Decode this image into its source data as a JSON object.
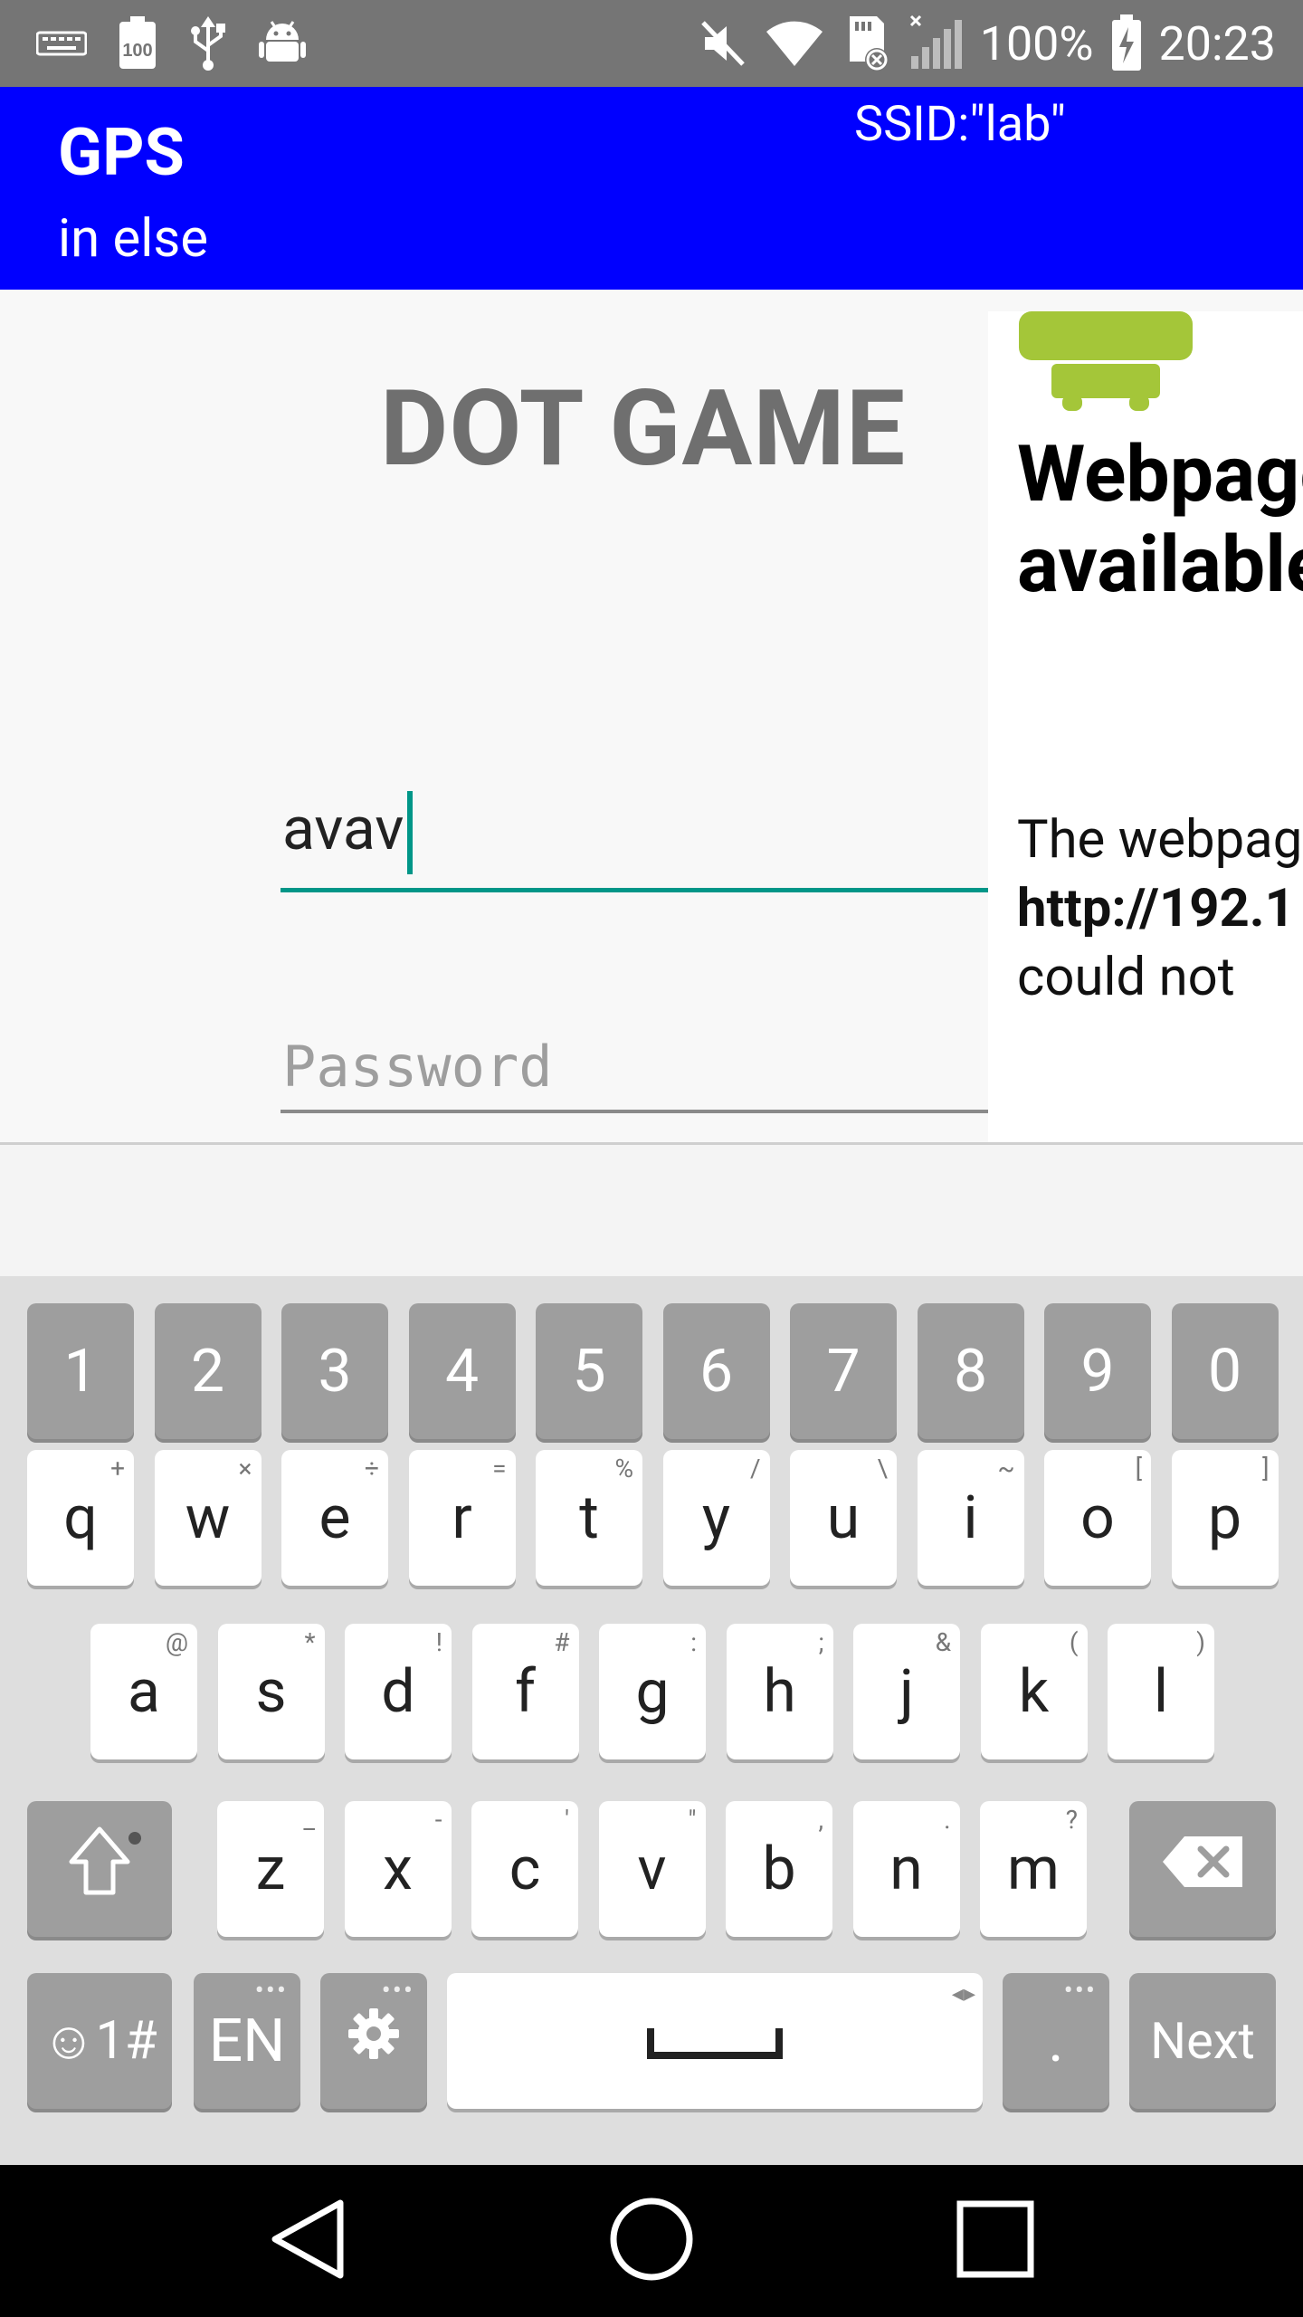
{
  "status_bar": {
    "battery_percent": "100%",
    "time": "20:23",
    "left_icons": [
      "keyboard-icon",
      "battery-100-icon",
      "usb-icon",
      "android-debug-icon"
    ],
    "right_icons": [
      "mute-icon",
      "wifi-icon",
      "sd-card-icon",
      "no-signal-icon",
      "battery-charging-icon"
    ]
  },
  "header": {
    "title": "GPS",
    "subtitle": "in else",
    "ssid": "SSID:\"lab\"",
    "color": "#0000ff"
  },
  "main": {
    "game_title": "DOT GAME",
    "username_value": "avav",
    "password_placeholder": "Password",
    "accent_color": "#009688"
  },
  "webview": {
    "heading": "Webpage not available",
    "message_prefix": "The webpage at",
    "url": "http://192.1",
    "message_suffix": "could not"
  },
  "keyboard": {
    "number_row": [
      "1",
      "2",
      "3",
      "4",
      "5",
      "6",
      "7",
      "8",
      "9",
      "0"
    ],
    "row1": [
      {
        "key": "q",
        "alt": "+"
      },
      {
        "key": "w",
        "alt": "×"
      },
      {
        "key": "e",
        "alt": "÷"
      },
      {
        "key": "r",
        "alt": "="
      },
      {
        "key": "t",
        "alt": "%"
      },
      {
        "key": "y",
        "alt": "/"
      },
      {
        "key": "u",
        "alt": "\\"
      },
      {
        "key": "i",
        "alt": "~"
      },
      {
        "key": "o",
        "alt": "["
      },
      {
        "key": "p",
        "alt": "]"
      }
    ],
    "row2": [
      {
        "key": "a",
        "alt": "@"
      },
      {
        "key": "s",
        "alt": "*"
      },
      {
        "key": "d",
        "alt": "!"
      },
      {
        "key": "f",
        "alt": "#"
      },
      {
        "key": "g",
        "alt": ":"
      },
      {
        "key": "h",
        "alt": ";"
      },
      {
        "key": "j",
        "alt": "&"
      },
      {
        "key": "k",
        "alt": "("
      },
      {
        "key": "l",
        "alt": ")"
      }
    ],
    "row3": [
      {
        "key": "z",
        "alt": "_"
      },
      {
        "key": "x",
        "alt": "-"
      },
      {
        "key": "c",
        "alt": "'"
      },
      {
        "key": "v",
        "alt": "\""
      },
      {
        "key": "b",
        "alt": ","
      },
      {
        "key": "n",
        "alt": "."
      },
      {
        "key": "m",
        "alt": "?"
      }
    ],
    "symbols_label": "☺1#",
    "language_label": "EN",
    "period_label": ".",
    "next_label": "Next",
    "icons": [
      "shift-icon",
      "backspace-icon",
      "settings-icon",
      "space-icon"
    ]
  },
  "nav": {
    "icons": [
      "back-icon",
      "home-icon",
      "recents-icon"
    ]
  }
}
